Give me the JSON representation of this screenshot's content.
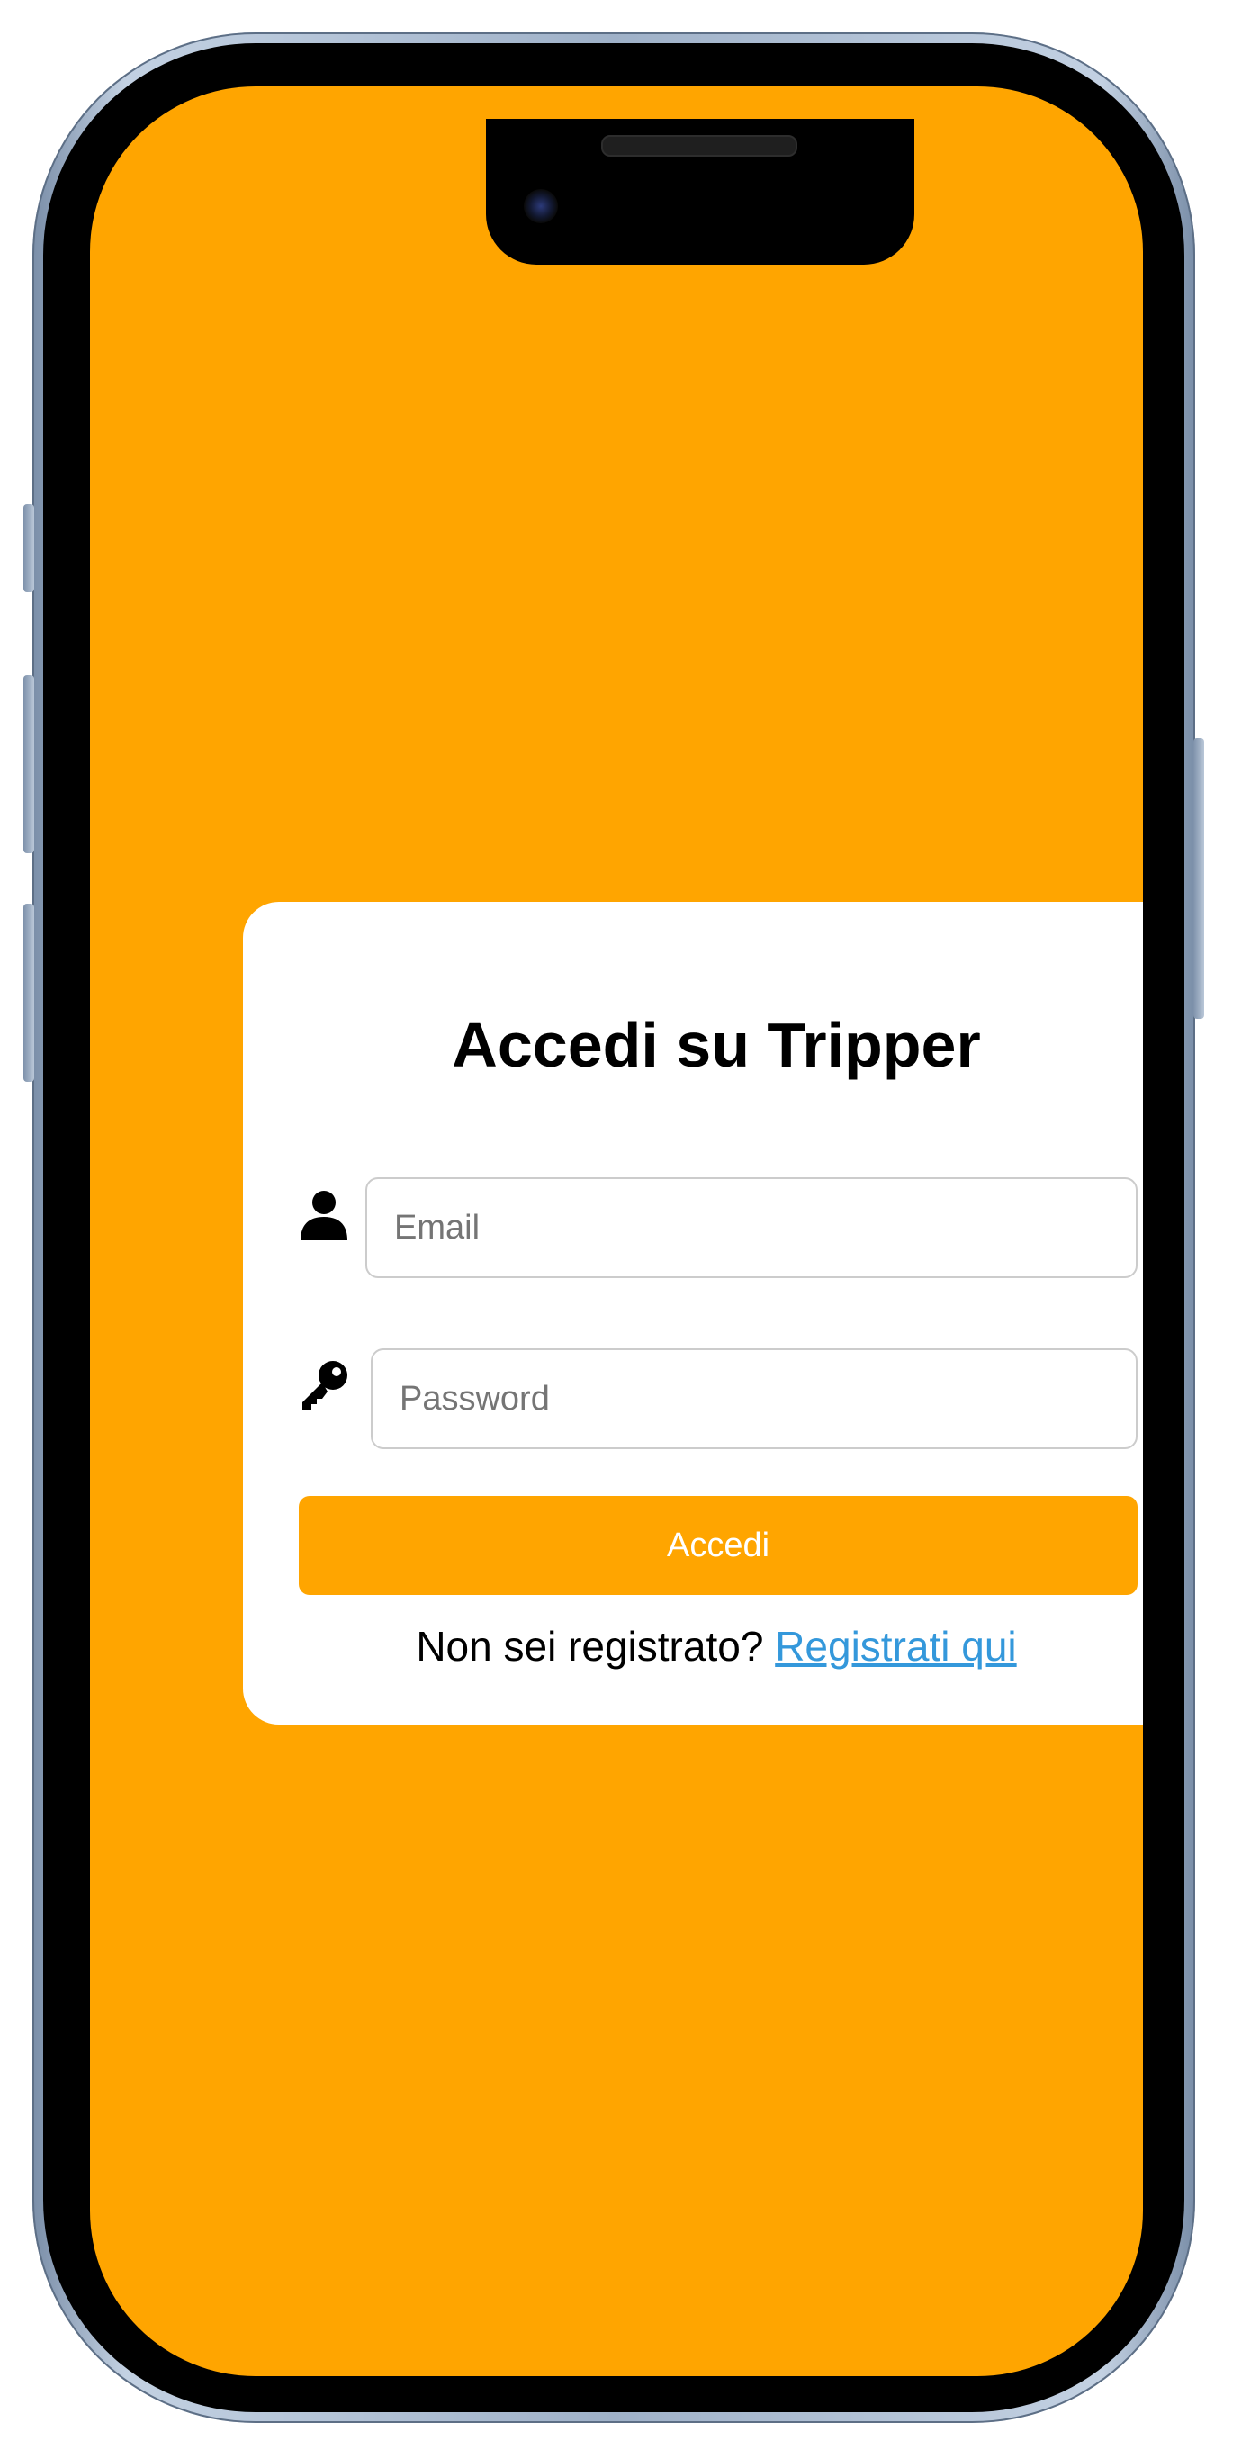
{
  "theme": {
    "background": "#FFA500",
    "card": "#FFFFFF",
    "button": "#FFA500",
    "link": "#3498DB"
  },
  "login": {
    "title": "Accedi su Tripper",
    "email_icon": "user-icon",
    "email_placeholder": "Email",
    "email_value": "",
    "password_icon": "key-icon",
    "password_placeholder": "Password",
    "password_value": "",
    "submit_label": "Accedi",
    "signup_prompt": "Non sei registrato?",
    "signup_link": "Registrati qui"
  }
}
